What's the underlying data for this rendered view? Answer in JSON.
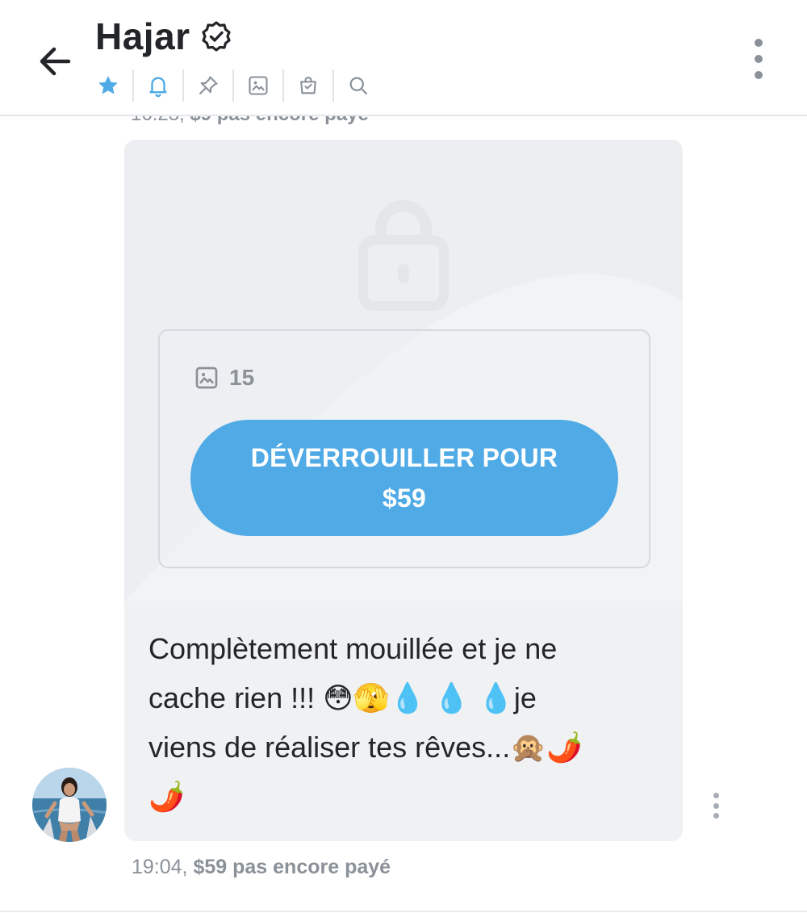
{
  "header": {
    "title": "Hajar",
    "verified": true,
    "toolbar_icons": [
      "star-icon",
      "bell-icon",
      "pin-icon",
      "image-icon",
      "shopping-bag-icon",
      "search-icon"
    ],
    "accent_color": "#4faae6"
  },
  "messages": {
    "previous": {
      "time": "16:23,",
      "status": "$9 pas encore payé"
    },
    "locked_post": {
      "photo_count": "15",
      "unlock_line1": "DÉVERROUILLER POUR",
      "unlock_line2": "$59",
      "text_line1": "Complètement mouillée et je ne",
      "text_line2": "cache rien !!! 😳🫣💧 💧 💧je",
      "text_line3": "viens de réaliser tes rêves...🙊🌶️",
      "text_line4": "🌶️",
      "time": "19:04,",
      "status": "$59 pas encore payé"
    }
  }
}
